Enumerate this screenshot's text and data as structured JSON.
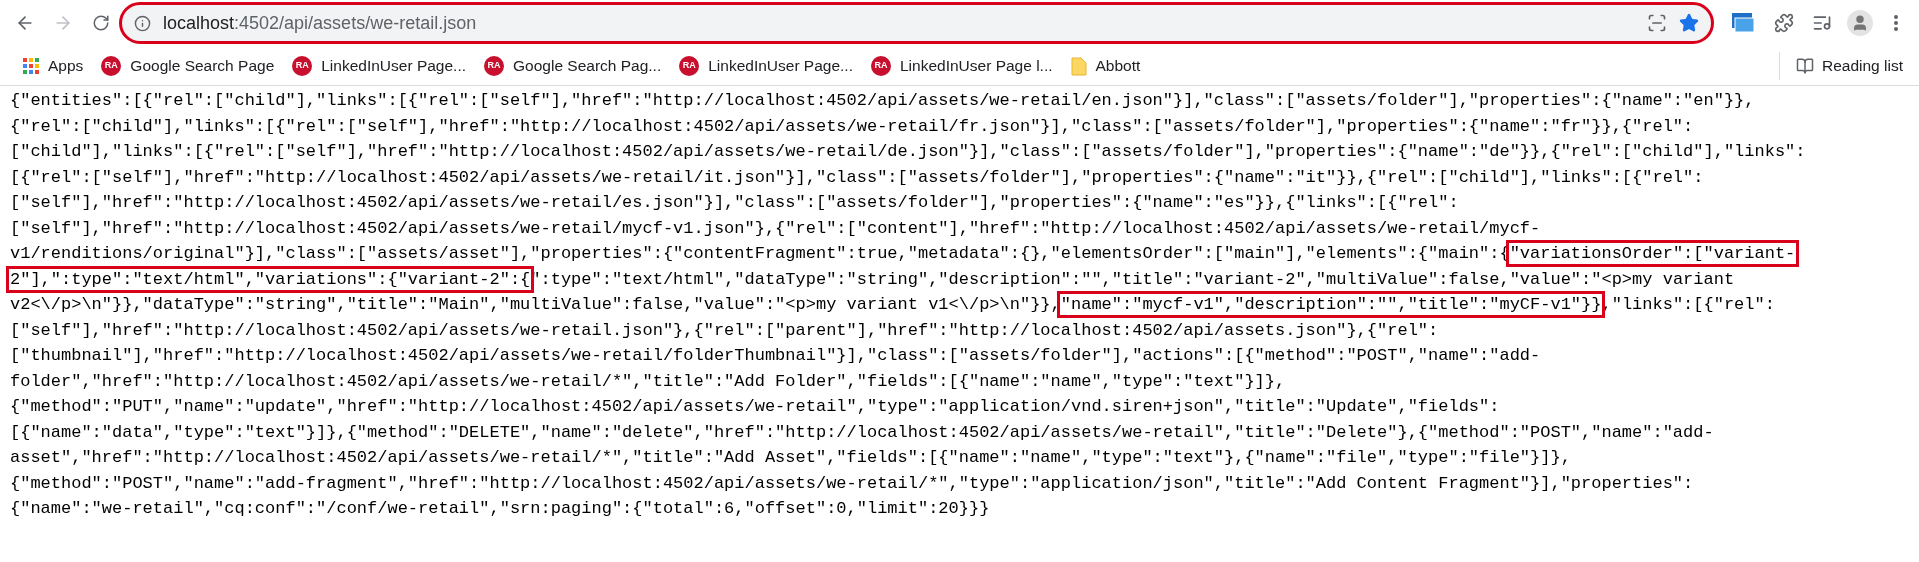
{
  "browser": {
    "address": {
      "host": "localhost",
      "path": ":4502/api/assets/we-retail.json",
      "annotated": true
    },
    "bookmarks": [
      {
        "kind": "apps",
        "label": "Apps"
      },
      {
        "kind": "site",
        "badge": "RA",
        "label": "Google Search Page"
      },
      {
        "kind": "site",
        "badge": "RA",
        "label": "LinkedInUser Page..."
      },
      {
        "kind": "site",
        "badge": "RA",
        "label": "Google Search Pag..."
      },
      {
        "kind": "site",
        "badge": "RA",
        "label": "LinkedInUser Page..."
      },
      {
        "kind": "site",
        "badge": "RA",
        "label": "LinkedInUser Page l..."
      },
      {
        "kind": "folder",
        "label": "Abbott"
      }
    ],
    "reading_list": "Reading list"
  },
  "document": {
    "lines": [
      [
        {
          "text": "{\"entities\":[{\"rel\":[\"child\"],\"links\":[{\"rel\":[\"self\"],\"href\":\"http://localhost:4502/api/assets/we-retail/en.json\"}],\"class\":[\"assets/folder\"],\"properties\":{\"name\":\"en\"}},"
        }
      ],
      [
        {
          "text": "{\"rel\":[\"child\"],\"links\":[{\"rel\":[\"self\"],\"href\":\"http://localhost:4502/api/assets/we-retail/fr.json\"}],\"class\":[\"assets/folder\"],\"properties\":{\"name\":\"fr\"}},{\"rel\":"
        }
      ],
      [
        {
          "text": "[\"child\"],\"links\":[{\"rel\":[\"self\"],\"href\":\"http://localhost:4502/api/assets/we-retail/de.json\"}],\"class\":[\"assets/folder\"],\"properties\":{\"name\":\"de\"}},{\"rel\":[\"child\"],\"links\":"
        }
      ],
      [
        {
          "text": "[{\"rel\":[\"self\"],\"href\":\"http://localhost:4502/api/assets/we-retail/it.json\"}],\"class\":[\"assets/folder\"],\"properties\":{\"name\":\"it\"}},{\"rel\":[\"child\"],\"links\":[{\"rel\":"
        }
      ],
      [
        {
          "text": "[\"self\"],\"href\":\"http://localhost:4502/api/assets/we-retail/es.json\"}],\"class\":[\"assets/folder\"],\"properties\":{\"name\":\"es\"}},{\"links\":[{\"rel\":"
        }
      ],
      [
        {
          "text": "[\"self\"],\"href\":\"http://localhost:4502/api/assets/we-retail/mycf-v1.json\"},{\"rel\":[\"content\"],\"href\":\"http://localhost:4502/api/assets/we-retail/mycf-"
        }
      ],
      [
        {
          "text": "v1/renditions/original\"}],\"class\":[\"assets/asset\"],\"properties\":{\"contentFragment\":true,\"metadata\":{},\"elementsOrder\":[\"main\"],\"elements\":{\"main\":{"
        },
        {
          "text": "\"variationsOrder\":[\"variant-",
          "annotated": true
        }
      ],
      [
        {
          "text": "2\"],\":type\":\"text/html\",\"variations\":{\"variant-2\":{",
          "annotated": true
        },
        {
          "text": "\":type\":\"text/html\",\"dataType\":\"string\",\"description\":\"\",\"title\":\"variant-2\",\"multiValue\":false,\"value\":\"<p>my variant"
        }
      ],
      [
        {
          "text": "v2<\\/p>\\n\"}},\"dataType\":\"string\",\"title\":\"Main\",\"multiValue\":false,\"value\":\"<p>my variant v1<\\/p>\\n\"}},"
        },
        {
          "text": "\"name\":\"mycf-v1\",\"description\":\"\",\"title\":\"myCF-v1\"}}",
          "annotated": true
        },
        {
          "text": ",\"links\":[{\"rel\":"
        }
      ],
      [
        {
          "text": "[\"self\"],\"href\":\"http://localhost:4502/api/assets/we-retail.json\"},{\"rel\":[\"parent\"],\"href\":\"http://localhost:4502/api/assets.json\"},{\"rel\":"
        }
      ],
      [
        {
          "text": "[\"thumbnail\"],\"href\":\"http://localhost:4502/api/assets/we-retail/folderThumbnail\"}],\"class\":[\"assets/folder\"],\"actions\":[{\"method\":\"POST\",\"name\":\"add-"
        }
      ],
      [
        {
          "text": "folder\",\"href\":\"http://localhost:4502/api/assets/we-retail/*\",\"title\":\"Add Folder\",\"fields\":[{\"name\":\"name\",\"type\":\"text\"}]},"
        }
      ],
      [
        {
          "text": "{\"method\":\"PUT\",\"name\":\"update\",\"href\":\"http://localhost:4502/api/assets/we-retail\",\"type\":\"application/vnd.siren+json\",\"title\":\"Update\",\"fields\":"
        }
      ],
      [
        {
          "text": "[{\"name\":\"data\",\"type\":\"text\"}]},{\"method\":\"DELETE\",\"name\":\"delete\",\"href\":\"http://localhost:4502/api/assets/we-retail\",\"title\":\"Delete\"},{\"method\":\"POST\",\"name\":\"add-"
        }
      ],
      [
        {
          "text": "asset\",\"href\":\"http://localhost:4502/api/assets/we-retail/*\",\"title\":\"Add Asset\",\"fields\":[{\"name\":\"name\",\"type\":\"text\"},{\"name\":\"file\",\"type\":\"file\"}]},"
        }
      ],
      [
        {
          "text": "{\"method\":\"POST\",\"name\":\"add-fragment\",\"href\":\"http://localhost:4502/api/assets/we-retail/*\",\"type\":\"application/json\",\"title\":\"Add Content Fragment\"}],\"properties\":"
        }
      ],
      [
        {
          "text": "{\"name\":\"we-retail\",\"cq:conf\":\"/conf/we-retail\",\"srn:paging\":{\"total\":6,\"offset\":0,\"limit\":20}}}"
        }
      ]
    ]
  }
}
